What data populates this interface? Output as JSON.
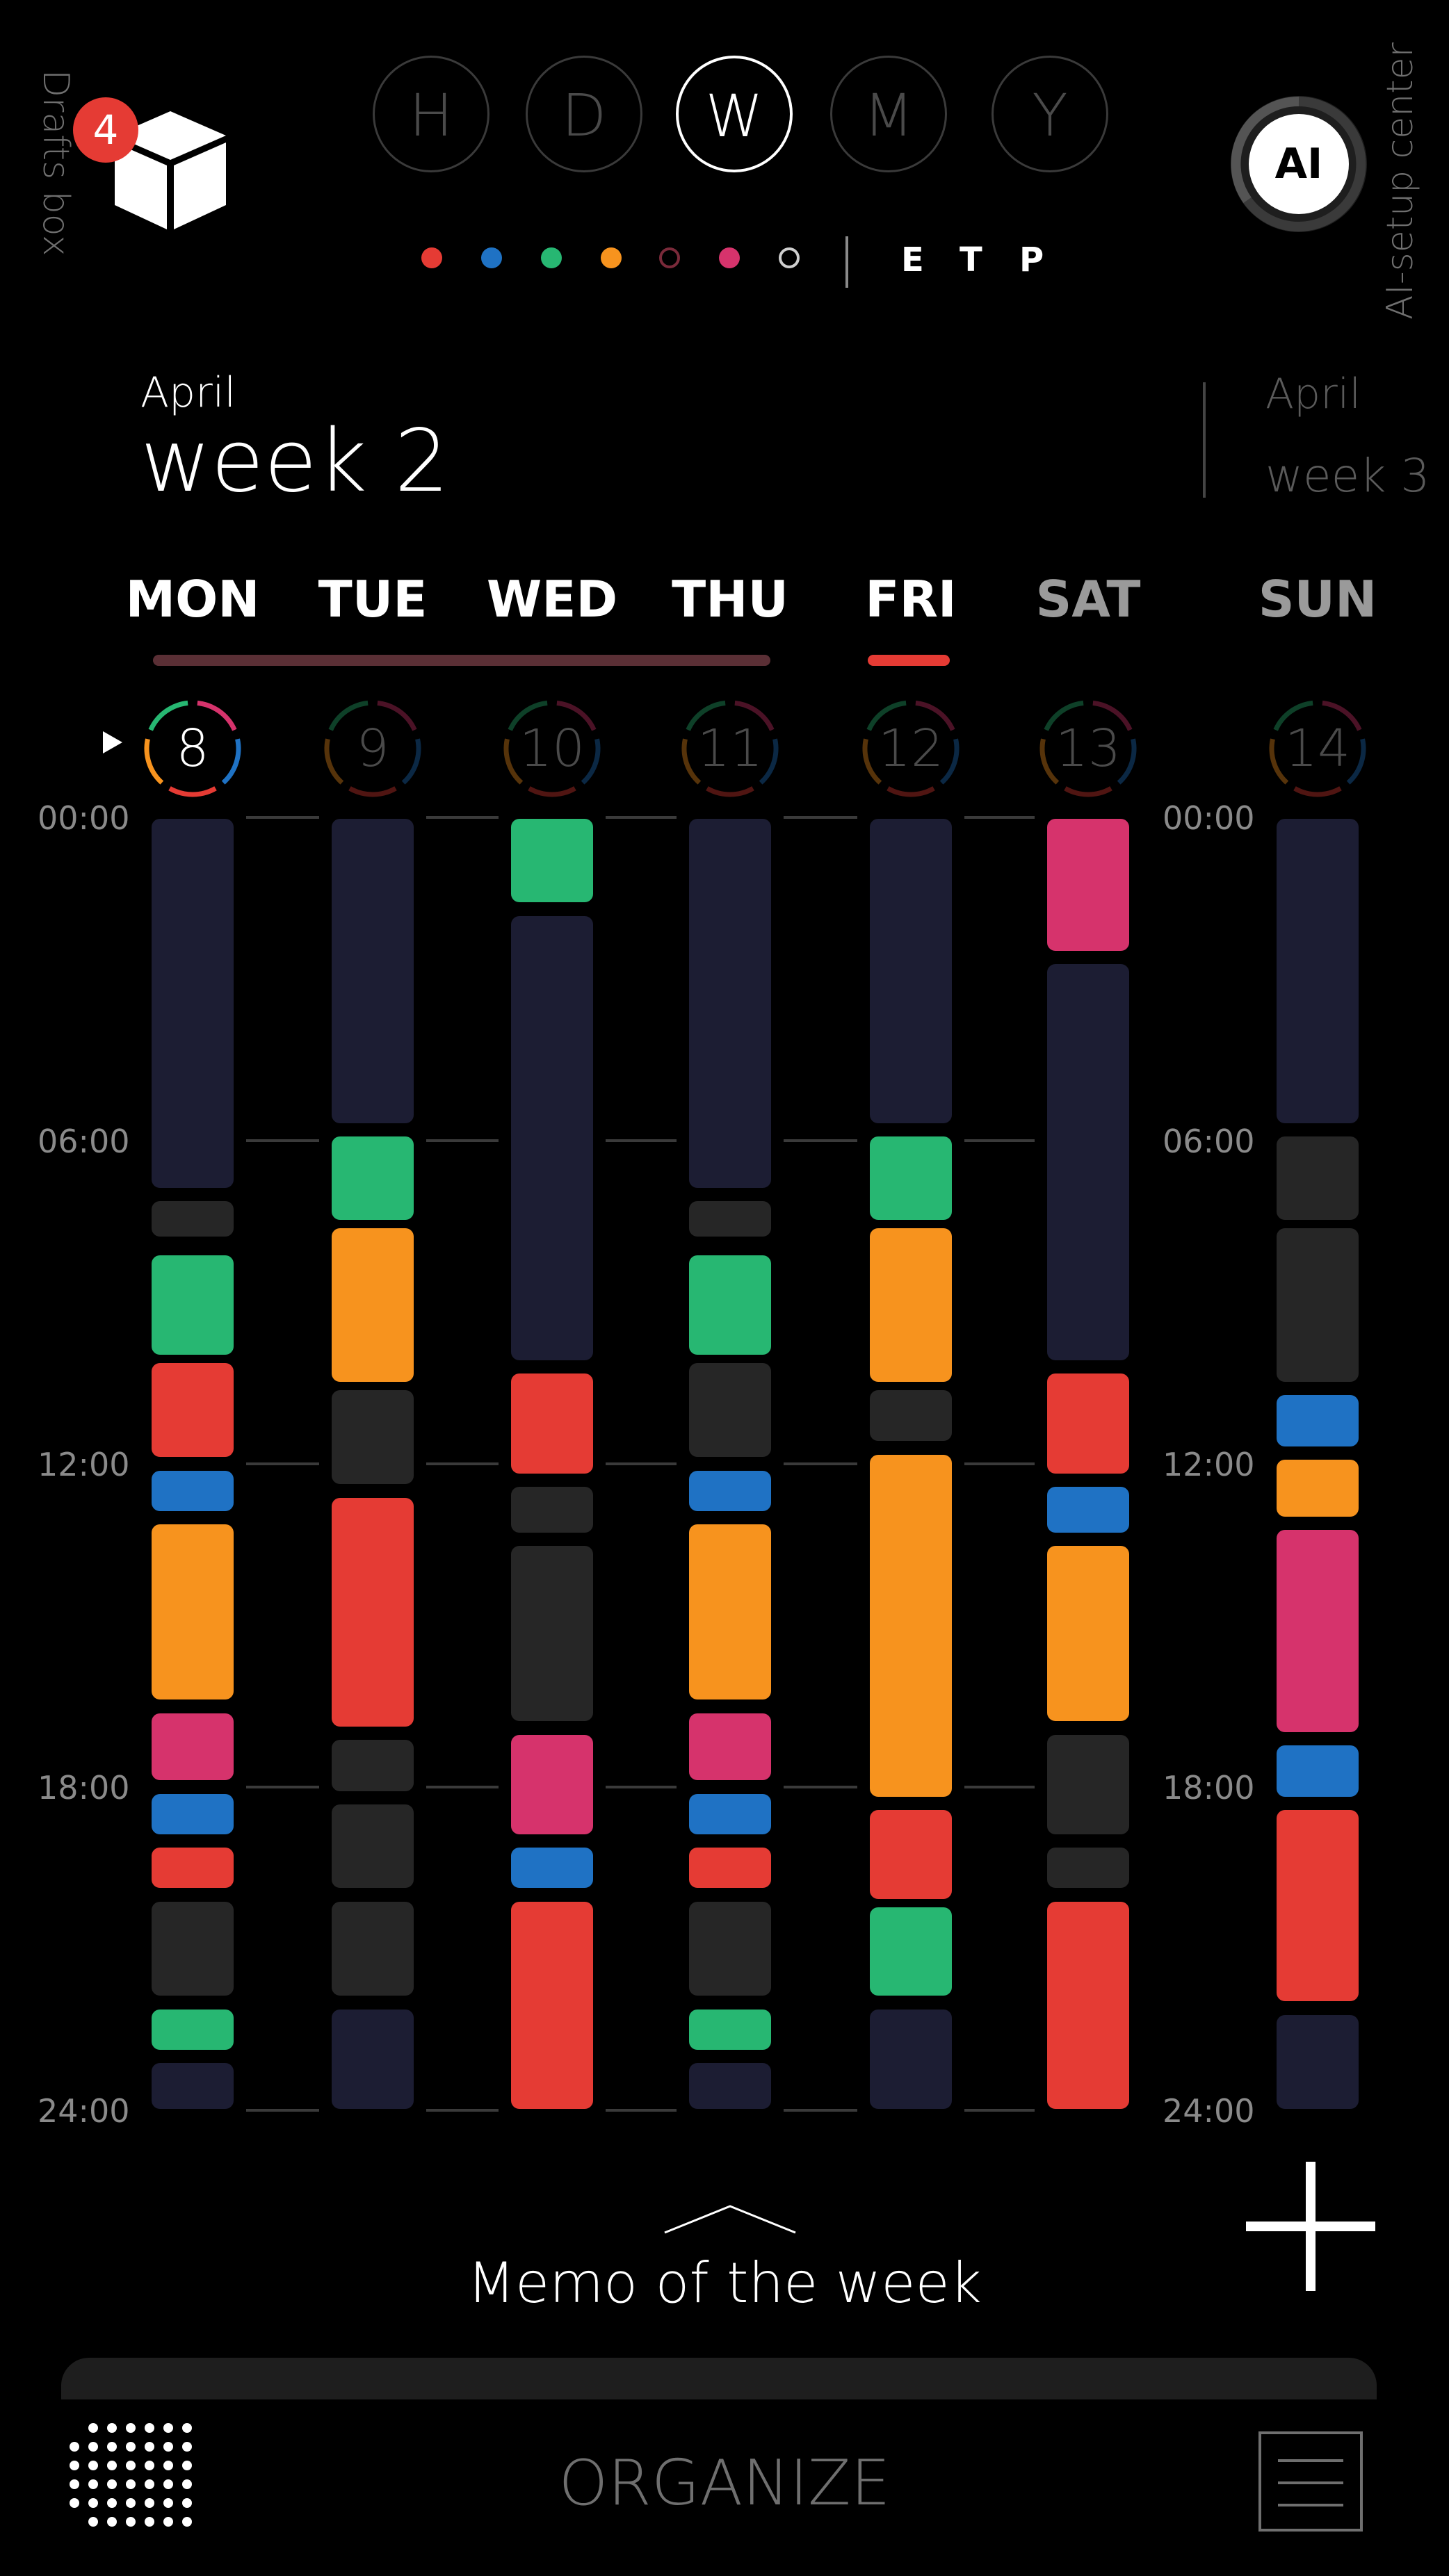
{
  "drafts": {
    "label": "Drafts box",
    "count": "4"
  },
  "ai": {
    "label": "AI-setup center",
    "button": "AI"
  },
  "periods": [
    {
      "label": "H",
      "active": false
    },
    {
      "label": "D",
      "active": false
    },
    {
      "label": "W",
      "active": true
    },
    {
      "label": "M",
      "active": false
    },
    {
      "label": "Y",
      "active": false
    }
  ],
  "legend": {
    "colors": [
      "#e53b34",
      "#1f72c4",
      "#27b772",
      "#f7931e",
      "#4a1a24",
      "#d6336c",
      "#ffffff"
    ],
    "toggles": [
      "E",
      "T",
      "P"
    ]
  },
  "current": {
    "month": "April",
    "week": "week 2"
  },
  "next": {
    "month": "April",
    "week": "week 3"
  },
  "palette": {
    "sleep": "#1c1d33",
    "dark": "#262626",
    "green": "#27b772",
    "red": "#e53b34",
    "blue": "#1f72c4",
    "orange": "#f7931e",
    "pink": "#d6336c"
  },
  "days": [
    {
      "name": "MON",
      "num": "8",
      "today": true,
      "weekend": false
    },
    {
      "name": "TUE",
      "num": "9",
      "today": false,
      "weekend": false
    },
    {
      "name": "WED",
      "num": "10",
      "today": false,
      "weekend": false
    },
    {
      "name": "THU",
      "num": "11",
      "today": false,
      "weekend": false
    },
    {
      "name": "FRI",
      "num": "12",
      "today": false,
      "weekend": false,
      "highlight": true
    },
    {
      "name": "SAT",
      "num": "13",
      "today": false,
      "weekend": true
    },
    {
      "name": "SUN",
      "num": "14",
      "today": false,
      "weekend": true
    }
  ],
  "time_labels": [
    "00:00",
    "06:00",
    "12:00",
    "18:00",
    "24:00"
  ],
  "schedule": [
    [
      [
        "sleep",
        0,
        6.9
      ],
      [
        "dark",
        7.1,
        7.8
      ],
      [
        "green",
        8.1,
        10.0
      ],
      [
        "red",
        10.1,
        11.9
      ],
      [
        "blue",
        12.1,
        12.9
      ],
      [
        "orange",
        13.1,
        16.4
      ],
      [
        "pink",
        16.6,
        17.9
      ],
      [
        "blue",
        18.1,
        18.9
      ],
      [
        "red",
        19.1,
        19.9
      ],
      [
        "dark",
        20.1,
        21.9
      ],
      [
        "green",
        22.1,
        22.9
      ],
      [
        "sleep",
        23.1,
        24
      ]
    ],
    [
      [
        "sleep",
        0,
        5.7
      ],
      [
        "green",
        5.9,
        7.5
      ],
      [
        "orange",
        7.6,
        10.5
      ],
      [
        "dark",
        10.6,
        12.4
      ],
      [
        "red",
        12.6,
        16.9
      ],
      [
        "dark",
        17.1,
        18.1
      ],
      [
        "dark",
        18.3,
        19.9
      ],
      [
        "dark",
        20.1,
        21.9
      ],
      [
        "sleep",
        22.1,
        24
      ]
    ],
    [
      [
        "green",
        0,
        1.6
      ],
      [
        "sleep",
        1.8,
        10.1
      ],
      [
        "red",
        10.3,
        12.2
      ],
      [
        "dark",
        12.4,
        13.3
      ],
      [
        "dark",
        13.5,
        16.8
      ],
      [
        "pink",
        17.0,
        18.9
      ],
      [
        "blue",
        19.1,
        19.9
      ],
      [
        "red",
        20.1,
        24
      ]
    ],
    [
      [
        "sleep",
        0,
        6.9
      ],
      [
        "dark",
        7.1,
        7.8
      ],
      [
        "green",
        8.1,
        10.0
      ],
      [
        "dark",
        10.1,
        11.9
      ],
      [
        "blue",
        12.1,
        12.9
      ],
      [
        "orange",
        13.1,
        16.4
      ],
      [
        "pink",
        16.6,
        17.9
      ],
      [
        "blue",
        18.1,
        18.9
      ],
      [
        "red",
        19.1,
        19.9
      ],
      [
        "dark",
        20.1,
        21.9
      ],
      [
        "green",
        22.1,
        22.9
      ],
      [
        "sleep",
        23.1,
        24
      ]
    ],
    [
      [
        "sleep",
        0,
        5.7
      ],
      [
        "green",
        5.9,
        7.5
      ],
      [
        "orange",
        7.6,
        10.5
      ],
      [
        "dark",
        10.6,
        11.6
      ],
      [
        "orange",
        11.8,
        18.2
      ],
      [
        "red",
        18.4,
        20.1
      ],
      [
        "green",
        20.2,
        21.9
      ],
      [
        "sleep",
        22.1,
        24
      ]
    ],
    [
      [
        "pink",
        0,
        2.5
      ],
      [
        "sleep",
        2.7,
        10.1
      ],
      [
        "red",
        10.3,
        12.2
      ],
      [
        "blue",
        12.4,
        13.3
      ],
      [
        "orange",
        13.5,
        16.8
      ],
      [
        "dark",
        17.0,
        18.9
      ],
      [
        "dark",
        19.1,
        19.9
      ],
      [
        "red",
        20.1,
        24
      ]
    ],
    [
      [
        "sleep",
        0,
        5.7
      ],
      [
        "dark",
        5.9,
        7.5
      ],
      [
        "dark",
        7.6,
        10.5
      ],
      [
        "blue",
        10.7,
        11.7
      ],
      [
        "orange",
        11.9,
        13.0
      ],
      [
        "pink",
        13.2,
        17.0
      ],
      [
        "blue",
        17.2,
        18.2
      ],
      [
        "red",
        18.4,
        22.0
      ],
      [
        "sleep",
        22.2,
        24
      ]
    ]
  ],
  "memo": "Memo of the week",
  "footer": {
    "title": "ORGANIZE"
  }
}
